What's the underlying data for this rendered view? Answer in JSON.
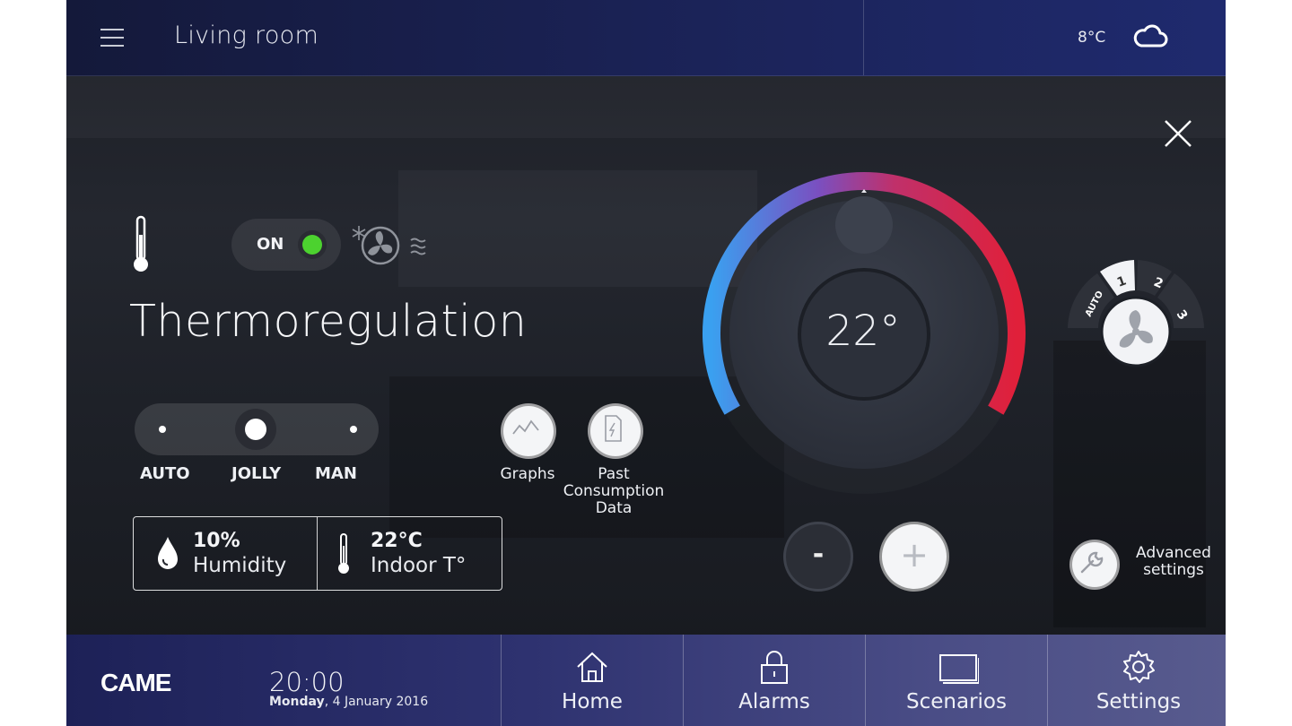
{
  "header": {
    "room": "Living room",
    "outdoor_temp": "8°C",
    "weather_icon": "cloud-icon",
    "menu_icon": "hamburger-menu-icon",
    "close_icon": "close-icon"
  },
  "thermo": {
    "title": "Thermoregulation",
    "power_label": "ON",
    "power_on": true,
    "modes": [
      "AUTO",
      "JOLLY",
      "MAN"
    ],
    "selected_mode": "JOLLY",
    "humidity_value": "10%",
    "humidity_label": "Humidity",
    "indoor_value": "22°C",
    "indoor_label": "Indoor T°",
    "setpoint": "22°",
    "graphs_label": "Graphs",
    "consumption_label": "Past\nConsumption\nData",
    "minus_label": "-",
    "plus_label": "+",
    "advanced_label": "Advanced\nsettings",
    "fan_speeds": [
      "AUTO",
      "1",
      "2",
      "3"
    ],
    "fan_selected": "1"
  },
  "footer": {
    "brand": "CAME",
    "time": "20:00",
    "weekday": "Monday",
    "date": ", 4 January 2016",
    "nav": [
      {
        "label": "Home",
        "icon": "home-icon"
      },
      {
        "label": "Alarms",
        "icon": "lock-icon"
      },
      {
        "label": "Scenarios",
        "icon": "scenarios-icon"
      },
      {
        "label": "Settings",
        "icon": "gear-icon"
      }
    ]
  },
  "colors": {
    "accent_green": "#4cd22f",
    "dial_cold": "#3aa0f0",
    "dial_hot": "#e0203a",
    "topbar": "#1b2358"
  }
}
